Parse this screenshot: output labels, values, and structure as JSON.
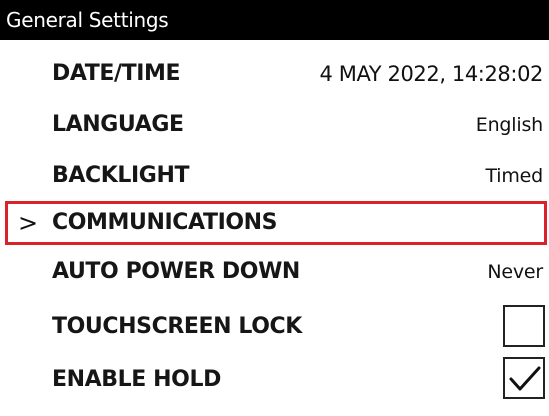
{
  "title": "General Settings",
  "rows": [
    {
      "label": "DATE/TIME",
      "value": "4 MAY 2022, 14:28:02"
    },
    {
      "label": "LANGUAGE",
      "value": "English"
    },
    {
      "label": "BACKLIGHT",
      "value": "Timed"
    },
    {
      "label": "COMMUNICATIONS",
      "selected": true,
      "indicator_icon": "chevron-right-icon"
    },
    {
      "label": "AUTO POWER DOWN",
      "value": "Never"
    },
    {
      "label": "TOUCHSCREEN LOCK",
      "checked": false
    },
    {
      "label": "ENABLE HOLD",
      "checked": true,
      "check_icon": "checkmark-icon"
    }
  ],
  "chevron_glyph": ">",
  "colors": {
    "title_bar_background": "#000000",
    "title_bar_text": "#ffffff",
    "selection_border": "#d9222a"
  }
}
